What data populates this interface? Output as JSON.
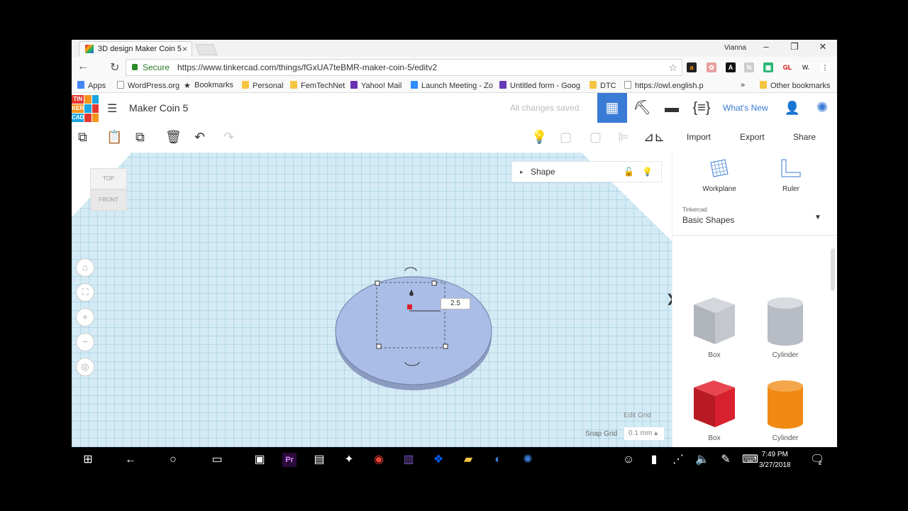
{
  "browser": {
    "tab_title": "3D design Maker Coin 5",
    "tab_close": "×",
    "user_label": "Vianna",
    "url_secure": "Secure",
    "url": "https://www.tinkercad.com/things/fGxUA7teBMR-maker-coin-5/editv2",
    "bookmarks": [
      "Apps",
      "WordPress.org",
      "Bookmarks",
      "Personal",
      "FemTechNet",
      "Yahoo! Mail",
      "Launch Meeting - Zo",
      "Untitled form - Goog",
      "DTC",
      "https://owl.english.p"
    ],
    "bookmarks_more": "»",
    "other_bookmarks": "Other bookmarks"
  },
  "tinkercad": {
    "logo": [
      "TIN",
      "KER",
      "CAD"
    ],
    "title": "Maker Coin 5",
    "save_status": "All changes saved",
    "whats_new": "What's New",
    "toolbar": {
      "import": "Import",
      "export": "Export",
      "share": "Share"
    },
    "viewcube": {
      "top": "TOP",
      "front": "FRONT"
    },
    "shape_panel_title": "Shape",
    "dimension_value": "2.5",
    "edit_grid": "Edit Grid",
    "snap_grid_label": "Snap Grid",
    "snap_grid_value": "0.1 mm",
    "right_panel": {
      "workplane": "Workplane",
      "ruler": "Ruler",
      "library_source": "Tinkercad",
      "library_name": "Basic Shapes",
      "shapes": [
        {
          "label": "Box",
          "color": "#b8bcc4"
        },
        {
          "label": "Cylinder",
          "color": "#b8bcc4"
        },
        {
          "label": "Box",
          "color": "#d8212e"
        },
        {
          "label": "Cylinder",
          "color": "#f08a12"
        }
      ]
    }
  },
  "taskbar": {
    "time": "7:49 PM",
    "date": "3/27/2018",
    "notification_count": "2"
  },
  "colors": {
    "accent": "#3a7bd5",
    "coin": "#a9bde6",
    "workplane": "#d4ebf5"
  }
}
